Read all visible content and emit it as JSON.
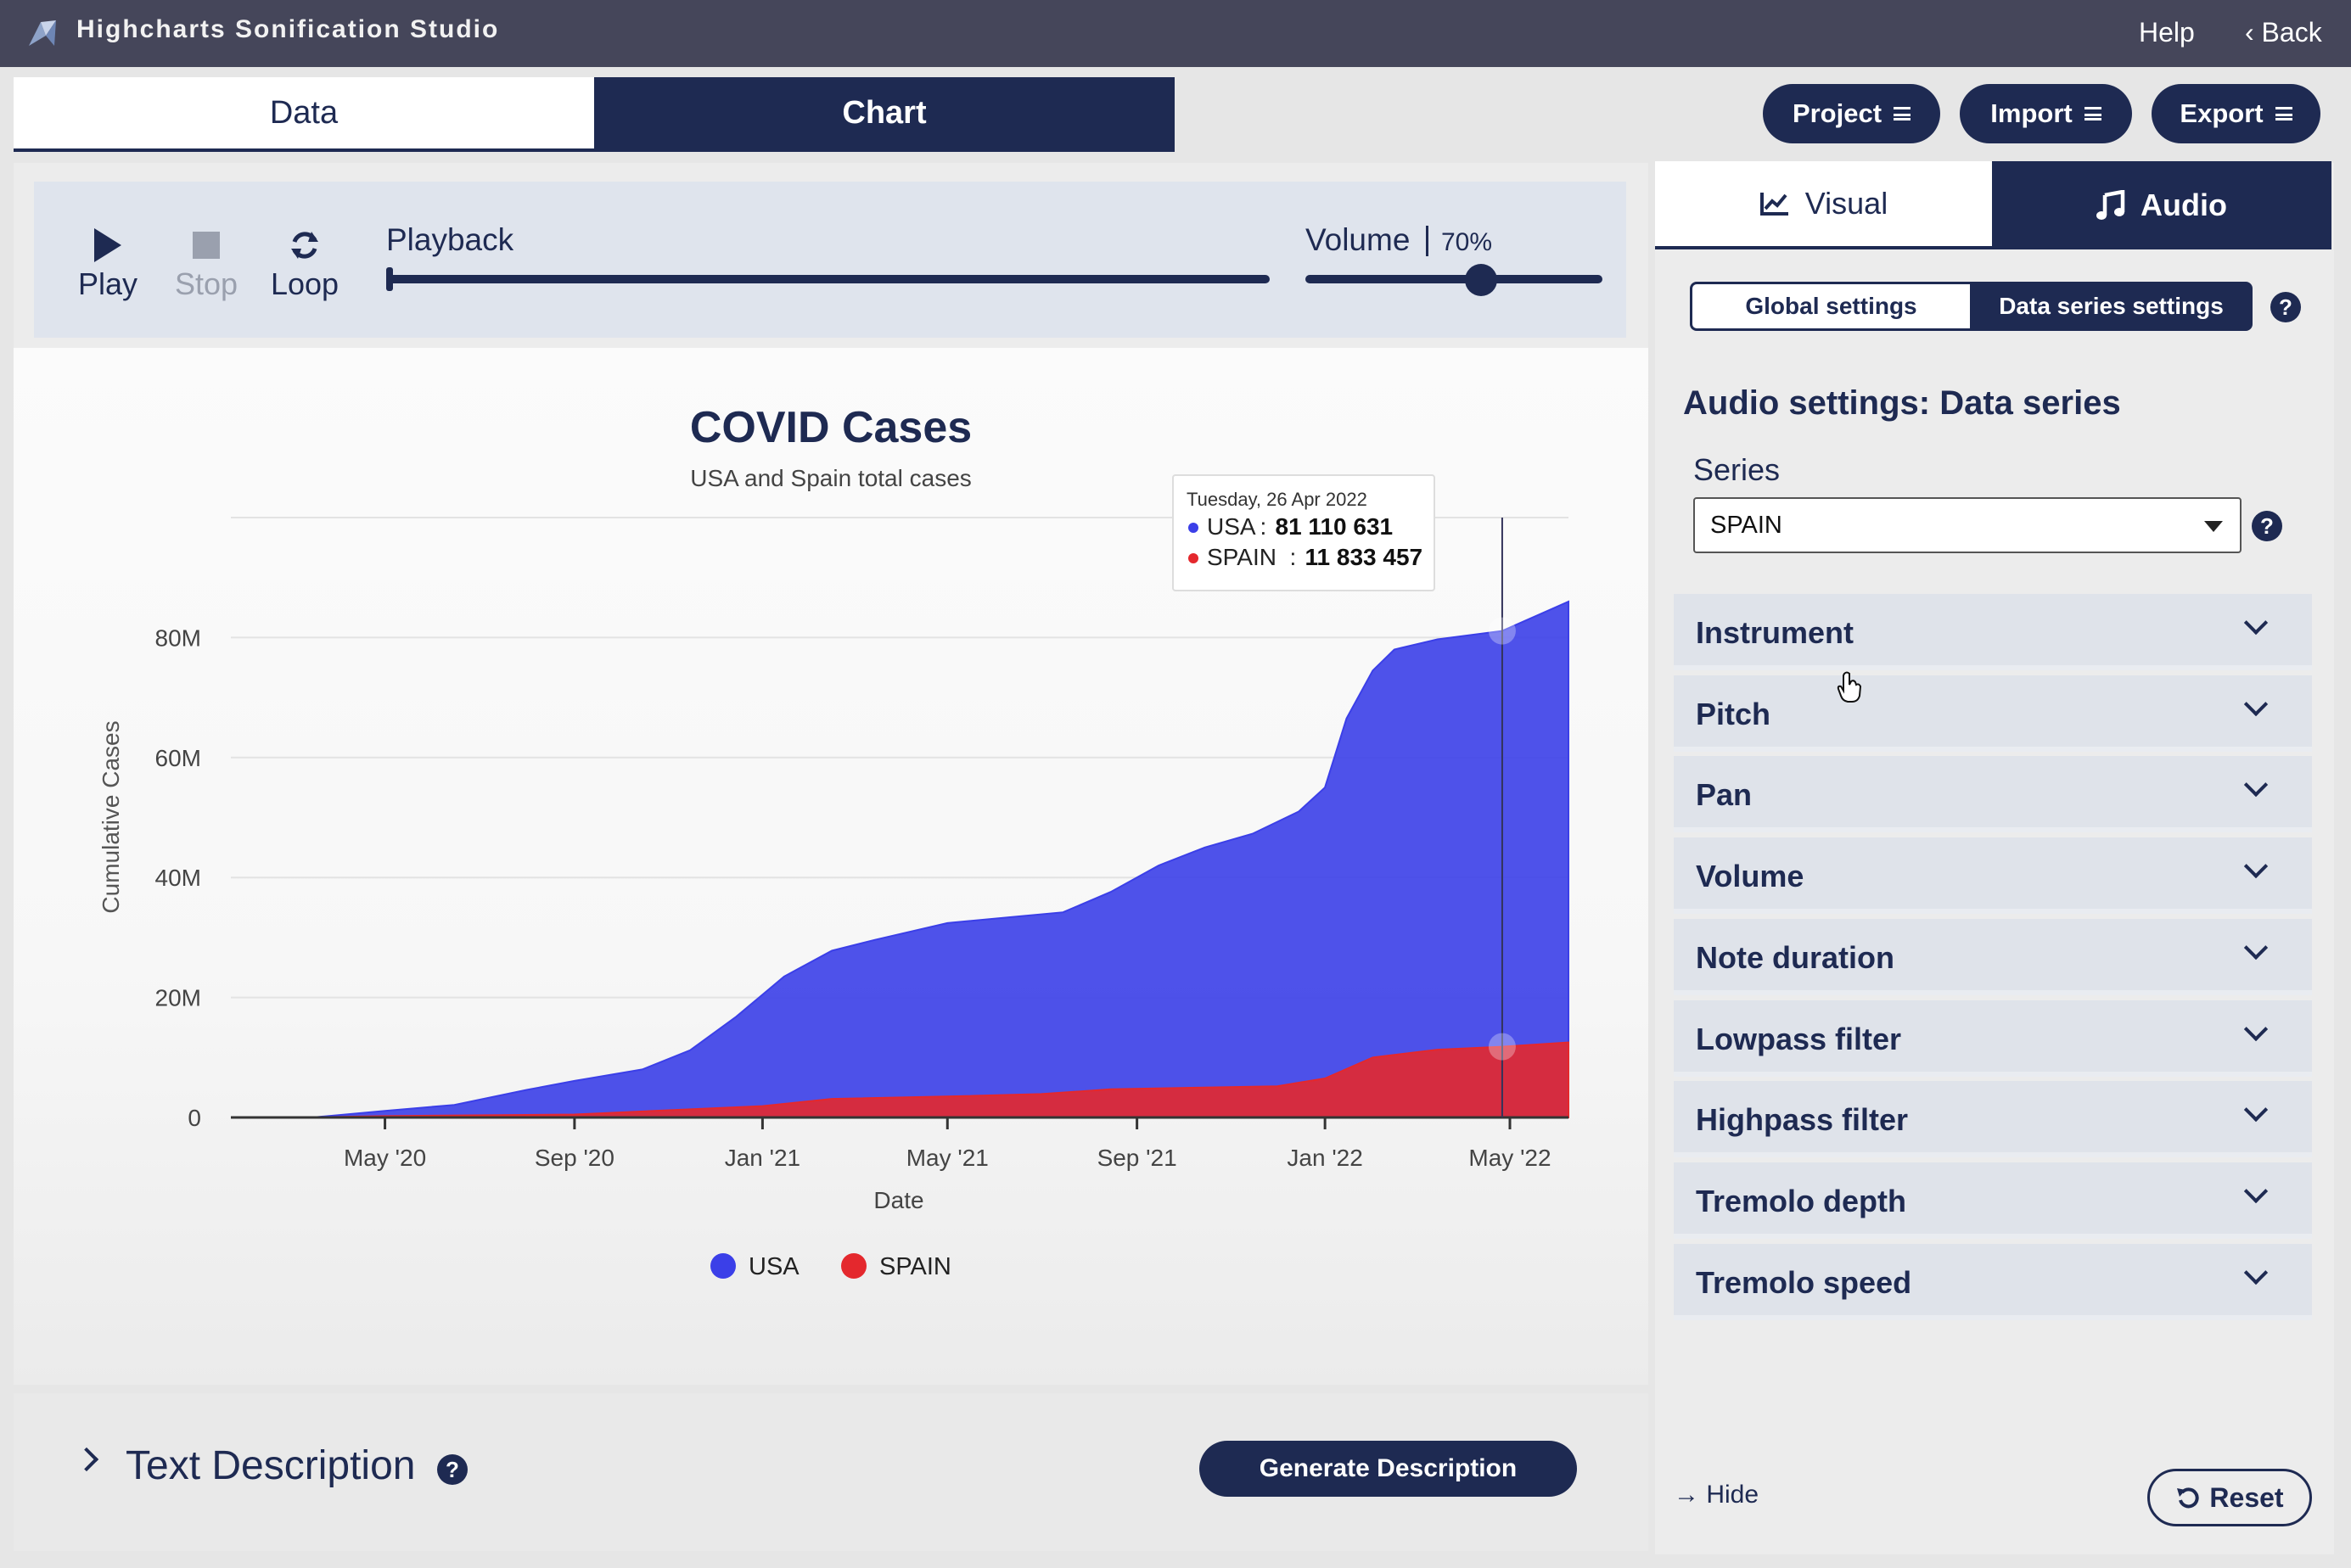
{
  "app": {
    "title": "Highcharts Sonification Studio",
    "help": "Help",
    "back": "Back"
  },
  "main_tabs": [
    {
      "label": "Data"
    },
    {
      "label": "Chart"
    }
  ],
  "header_buttons": [
    {
      "label": "Project"
    },
    {
      "label": "Import"
    },
    {
      "label": "Export"
    }
  ],
  "player": {
    "play": "Play",
    "stop": "Stop",
    "loop": "Loop",
    "playback_label": "Playback",
    "playback_progress": 0,
    "volume_label": "Volume",
    "volume_value": "70%",
    "volume_level": 0.7
  },
  "chart_data": {
    "type": "area",
    "title": "COVID Cases",
    "subtitle": "USA and Spain total cases",
    "xlabel": "Date",
    "ylabel": "Cumulative Cases",
    "yticks": [
      "0",
      "20M",
      "40M",
      "60M",
      "80M"
    ],
    "ylim": [
      0,
      100000000
    ],
    "xticks": [
      {
        "date": "2020-05-01",
        "label": "May '20"
      },
      {
        "date": "2020-09-01",
        "label": "Sep '20"
      },
      {
        "date": "2021-01-01",
        "label": "Jan '21"
      },
      {
        "date": "2021-05-01",
        "label": "May '21"
      },
      {
        "date": "2021-09-01",
        "label": "Sep '21"
      },
      {
        "date": "2022-01-01",
        "label": "Jan '22"
      },
      {
        "date": "2022-05-01",
        "label": "May '22"
      }
    ],
    "xlim": [
      "2020-01-22",
      "2022-06-08"
    ],
    "legend_position": "bottom",
    "grid": true,
    "series": [
      {
        "name": "USA",
        "color": "#3b3fe8",
        "points": [
          [
            "2020-01-22",
            0
          ],
          [
            "2020-03-15",
            0.003
          ],
          [
            "2020-05-01",
            1.1
          ],
          [
            "2020-06-15",
            2.1
          ],
          [
            "2020-08-01",
            4.6
          ],
          [
            "2020-09-01",
            6.1
          ],
          [
            "2020-10-15",
            8.0
          ],
          [
            "2020-11-15",
            11.2
          ],
          [
            "2020-12-15",
            16.8
          ],
          [
            "2021-01-15",
            23.5
          ],
          [
            "2021-02-15",
            27.8
          ],
          [
            "2021-03-15",
            29.6
          ],
          [
            "2021-05-01",
            32.4
          ],
          [
            "2021-06-15",
            33.5
          ],
          [
            "2021-07-15",
            34.2
          ],
          [
            "2021-08-15",
            37.6
          ],
          [
            "2021-09-15",
            42.0
          ],
          [
            "2021-10-15",
            45.0
          ],
          [
            "2021-11-15",
            47.3
          ],
          [
            "2021-12-15",
            51.0
          ],
          [
            "2022-01-01",
            55.0
          ],
          [
            "2022-01-15",
            66.5
          ],
          [
            "2022-02-01",
            74.5
          ],
          [
            "2022-02-15",
            78.0
          ],
          [
            "2022-03-15",
            79.7
          ],
          [
            "2022-04-26",
            81.1
          ],
          [
            "2022-06-08",
            86.0
          ]
        ]
      },
      {
        "name": "SPAIN",
        "color": "#e4282d",
        "points": [
          [
            "2020-01-22",
            0
          ],
          [
            "2020-03-15",
            0.01
          ],
          [
            "2020-05-01",
            0.22
          ],
          [
            "2020-09-01",
            0.5
          ],
          [
            "2020-11-01",
            1.2
          ],
          [
            "2021-01-01",
            1.9
          ],
          [
            "2021-02-15",
            3.1
          ],
          [
            "2021-05-01",
            3.5
          ],
          [
            "2021-07-01",
            3.9
          ],
          [
            "2021-08-15",
            4.7
          ],
          [
            "2021-12-01",
            5.2
          ],
          [
            "2022-01-01",
            6.5
          ],
          [
            "2022-02-01",
            10.0
          ],
          [
            "2022-03-15",
            11.3
          ],
          [
            "2022-04-26",
            11.8
          ],
          [
            "2022-06-08",
            12.5
          ]
        ]
      }
    ],
    "tooltip": {
      "date_label": "Tuesday, 26 Apr 2022",
      "date": "2022-04-26",
      "rows": [
        {
          "name": "USA",
          "value": "81 110 631",
          "color": "#3b3fe8"
        },
        {
          "name": "SPAIN",
          "value": "11 833 457",
          "color": "#e4282d"
        }
      ]
    }
  },
  "description": {
    "title": "Text Description",
    "help_icon": "question-icon",
    "generate": "Generate Description"
  },
  "settings": {
    "tabs": [
      {
        "label": "Visual",
        "icon": "line-chart-icon"
      },
      {
        "label": "Audio",
        "icon": "music-note-icon"
      }
    ],
    "segments": [
      {
        "label": "Global settings"
      },
      {
        "label": "Data series settings"
      }
    ],
    "title": "Audio settings: Data series",
    "series_label": "Series",
    "series_value": "SPAIN",
    "sections": [
      "Instrument",
      "Pitch",
      "Pan",
      "Volume",
      "Note duration",
      "Lowpass filter",
      "Highpass filter",
      "Tremolo depth",
      "Tremolo speed"
    ],
    "hide": "Hide",
    "reset": "Reset"
  }
}
